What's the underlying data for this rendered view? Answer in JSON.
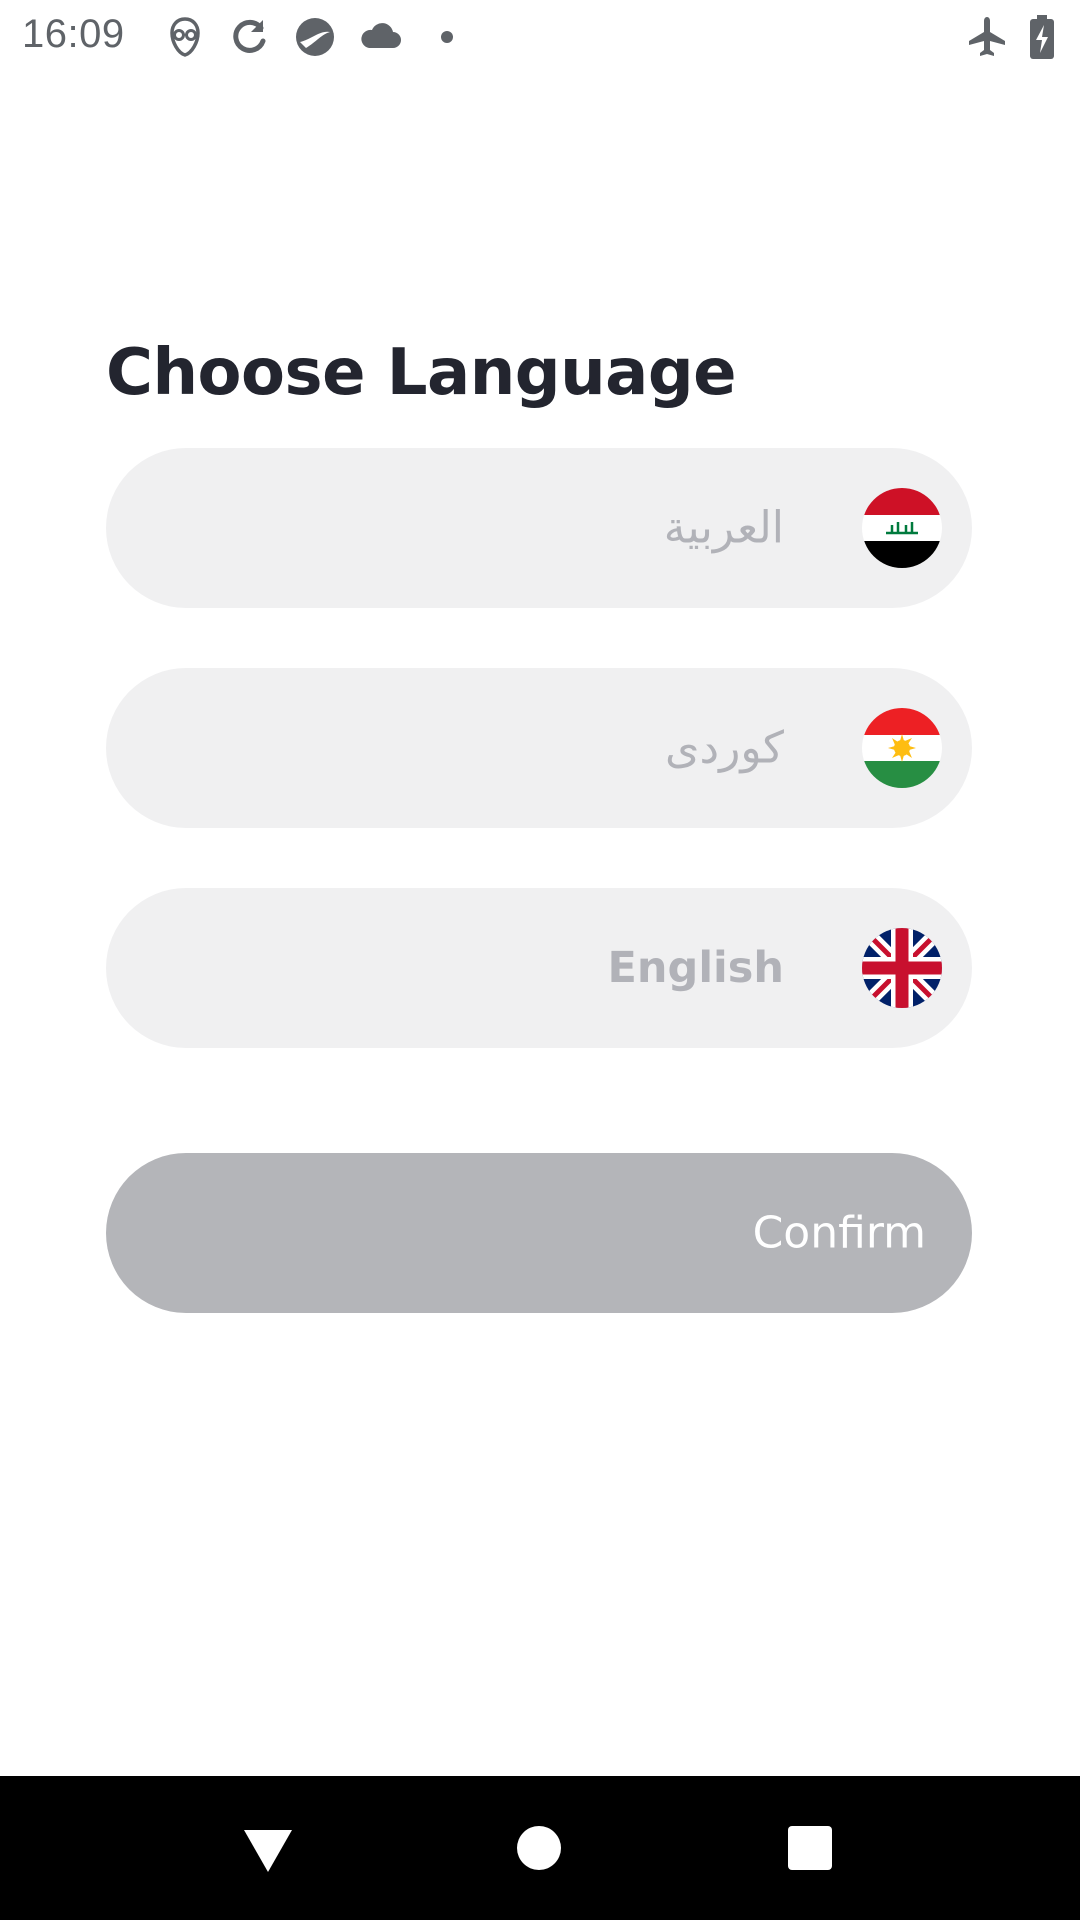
{
  "status_bar": {
    "time": "16:09",
    "icons": [
      "alien-icon",
      "sync-icon",
      "trend-icon",
      "cloud-icon",
      "dot-icon",
      "airplane-mode-icon",
      "battery-charging-icon"
    ]
  },
  "screen": {
    "title": "Choose Language"
  },
  "languages": [
    {
      "label": "العربية",
      "flag": "iraq-flag-icon"
    },
    {
      "label": "كوردى",
      "flag": "kurdistan-flag-icon"
    },
    {
      "label": "English",
      "flag": "uk-flag-icon"
    }
  ],
  "confirm": {
    "label": "Confirm",
    "bg_color": "#b4b5b9"
  },
  "colors": {
    "option_bg": "#f0f0f1",
    "option_text": "#b1b2b8",
    "title_text": "#23252f"
  },
  "nav_bar": {
    "icons": [
      "back-icon",
      "home-icon",
      "recents-icon"
    ]
  }
}
